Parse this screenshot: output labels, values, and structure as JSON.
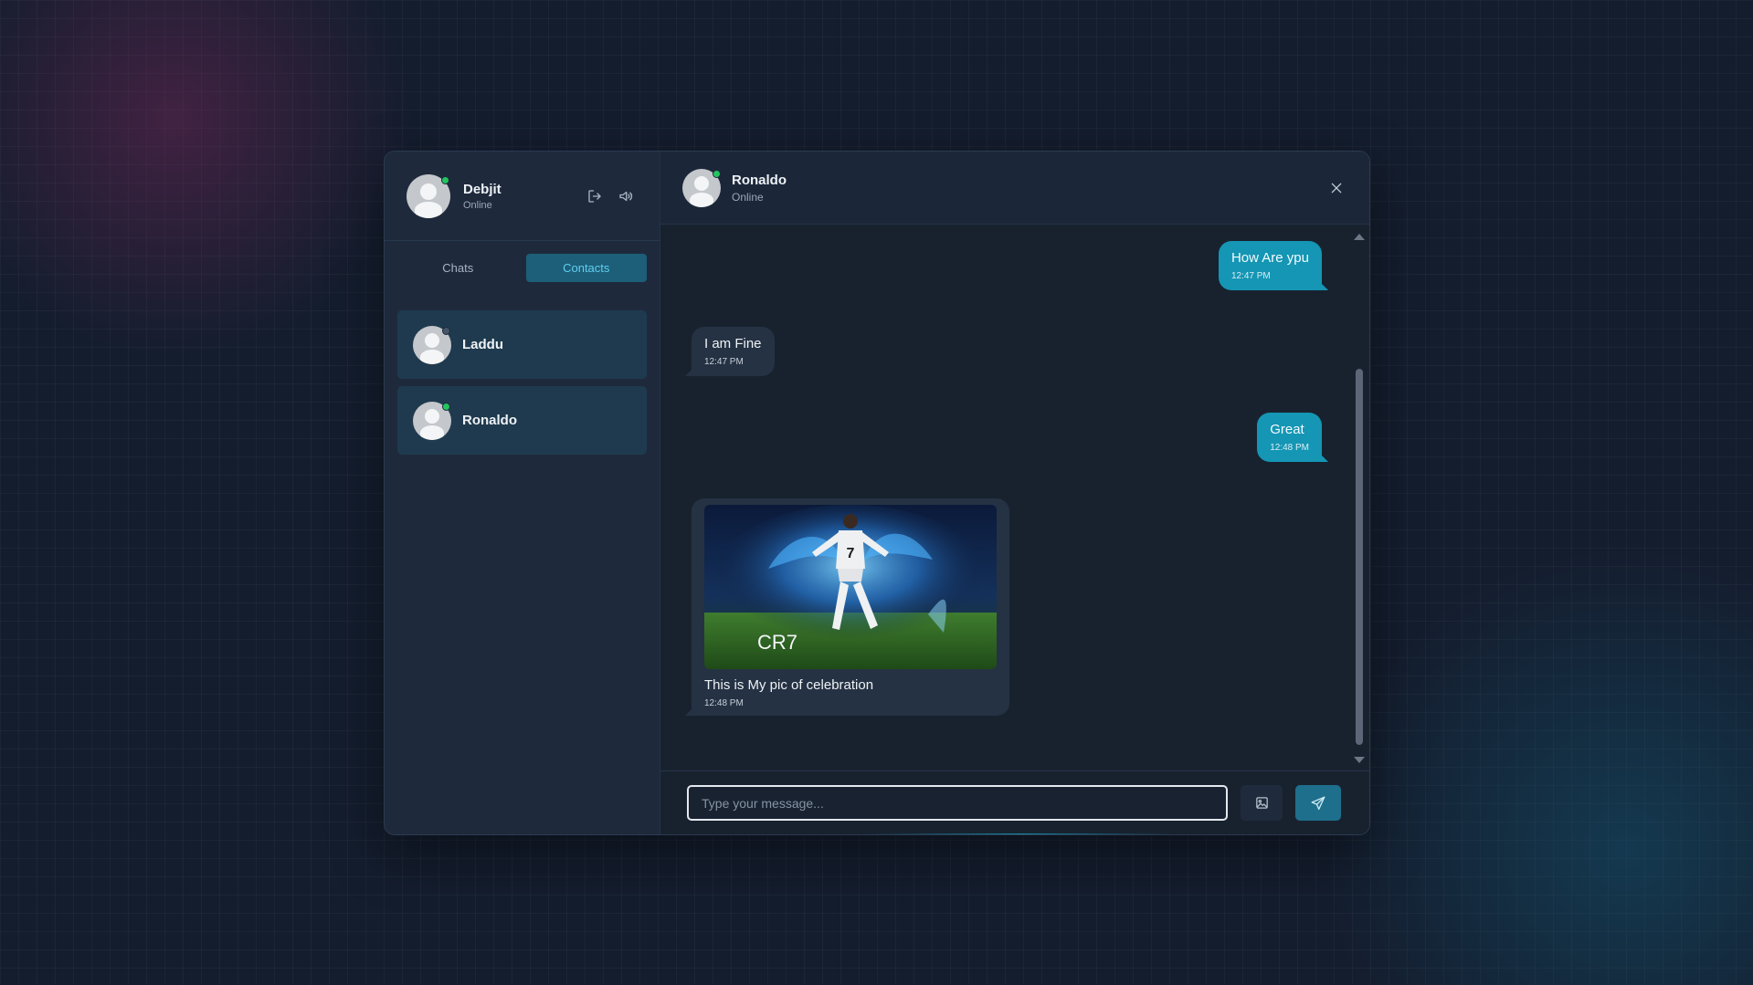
{
  "colors": {
    "accent": "#1496b4",
    "active_tab_bg": "#1d5e79",
    "online": "#22c55e",
    "offline": "#475569"
  },
  "me": {
    "name": "Debjit",
    "status": "Online",
    "status_color": "online"
  },
  "sidebar": {
    "header_icons": [
      "logout-icon",
      "speaker-icon"
    ],
    "tabs": [
      {
        "label": "Chats",
        "active": false
      },
      {
        "label": "Contacts",
        "active": true
      }
    ],
    "contacts": [
      {
        "name": "Laddu",
        "status": "offline"
      },
      {
        "name": "Ronaldo",
        "status": "online"
      }
    ]
  },
  "chat": {
    "contact_name": "Ronaldo",
    "contact_status": "Online",
    "messages": [
      {
        "direction": "out",
        "text": "How Are ypu",
        "time": "12:47 PM"
      },
      {
        "direction": "in",
        "text": "I am Fine",
        "time": "12:47 PM"
      },
      {
        "direction": "out",
        "text": "Great",
        "time": "12:48 PM"
      },
      {
        "direction": "in",
        "type": "image",
        "image_caption_overlay": "CR7",
        "text": "This is My pic of celebration",
        "time": "12:48 PM"
      }
    ]
  },
  "composer": {
    "placeholder": "Type your message...",
    "value": "",
    "icons": [
      "image-icon",
      "send-icon"
    ]
  }
}
